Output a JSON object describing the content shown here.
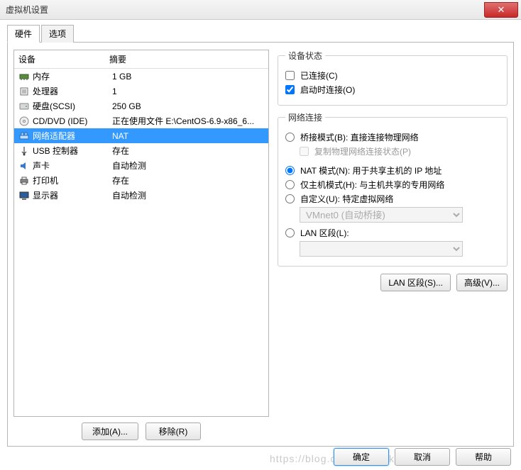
{
  "window": {
    "title": "虚拟机设置"
  },
  "tabs": {
    "hardware": "硬件",
    "options": "选项"
  },
  "hw": {
    "col_device": "设备",
    "col_summary": "摘要",
    "rows": [
      {
        "label": "内存",
        "summary": "1 GB"
      },
      {
        "label": "处理器",
        "summary": "1"
      },
      {
        "label": "硬盘(SCSI)",
        "summary": "250 GB"
      },
      {
        "label": "CD/DVD (IDE)",
        "summary": "正在使用文件 E:\\CentOS-6.9-x86_6..."
      },
      {
        "label": "网络适配器",
        "summary": "NAT"
      },
      {
        "label": "USB 控制器",
        "summary": "存在"
      },
      {
        "label": "声卡",
        "summary": "自动检测"
      },
      {
        "label": "打印机",
        "summary": "存在"
      },
      {
        "label": "显示器",
        "summary": "自动检测"
      }
    ],
    "add_btn": "添加(A)...",
    "remove_btn": "移除(R)"
  },
  "state": {
    "legend": "设备状态",
    "connected": "已连接(C)",
    "connect_at_poweron": "启动时连接(O)"
  },
  "net": {
    "legend": "网络连接",
    "bridged": "桥接模式(B): 直接连接物理网络",
    "replicate": "复制物理网络连接状态(P)",
    "nat": "NAT 模式(N): 用于共享主机的 IP 地址",
    "hostonly": "仅主机模式(H): 与主机共享的专用网络",
    "custom": "自定义(U): 特定虚拟网络",
    "custom_sel": "VMnet0 (自动桥接)",
    "lanseg": "LAN 区段(L):",
    "lanseg_sel": "",
    "lanseg_btn": "LAN 区段(S)...",
    "adv_btn": "高级(V)..."
  },
  "footer": {
    "ok": "确定",
    "cancel": "取消",
    "help": "帮助"
  },
  "watermark": "https://blog.csdn.net/kokjuis"
}
